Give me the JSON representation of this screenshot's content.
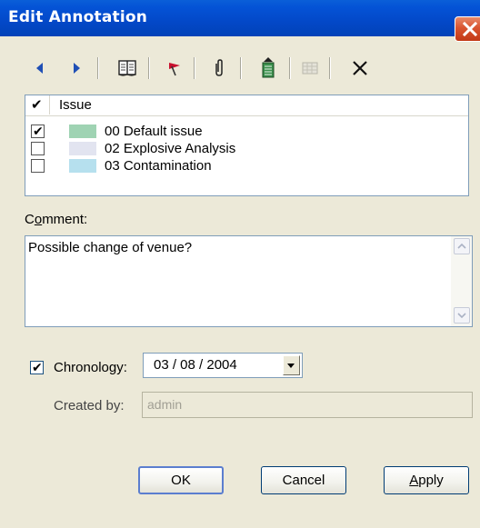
{
  "window": {
    "title": "Edit Annotation"
  },
  "toolbar": {
    "icons": [
      "arrow-left-icon",
      "arrow-right-icon",
      "book-icon",
      "flag-icon",
      "paperclip-icon",
      "document-arrow-icon",
      "grid-disabled-icon",
      "close-x-icon"
    ]
  },
  "issues": {
    "header_check": "✔",
    "header_label": "Issue",
    "items": [
      {
        "label": "00 Default issue",
        "checked": true,
        "color": "#9fd3b3"
      },
      {
        "label": "02 Explosive Analysis",
        "checked": false,
        "color": "#e2e4f0"
      },
      {
        "label": "03 Contamination",
        "checked": false,
        "color": "#b6e0ee"
      }
    ]
  },
  "comment": {
    "label_pre": "C",
    "label_u": "o",
    "label_post": "mment:",
    "value": "Possible change of venue?"
  },
  "chronology": {
    "checked": true,
    "check_mark": "✔",
    "label": "Chronology:",
    "date": "03 / 08 / 2004"
  },
  "created_by": {
    "label": "Created by:",
    "value": "admin"
  },
  "buttons": {
    "ok": "OK",
    "cancel": "Cancel",
    "apply_u": "A",
    "apply_rest": "pply"
  },
  "colors": {
    "titlebar": "#0453d6",
    "dialog_bg": "#ece9d8",
    "field_border": "#7f9db9",
    "default_button_border": "#5b7ecf"
  }
}
